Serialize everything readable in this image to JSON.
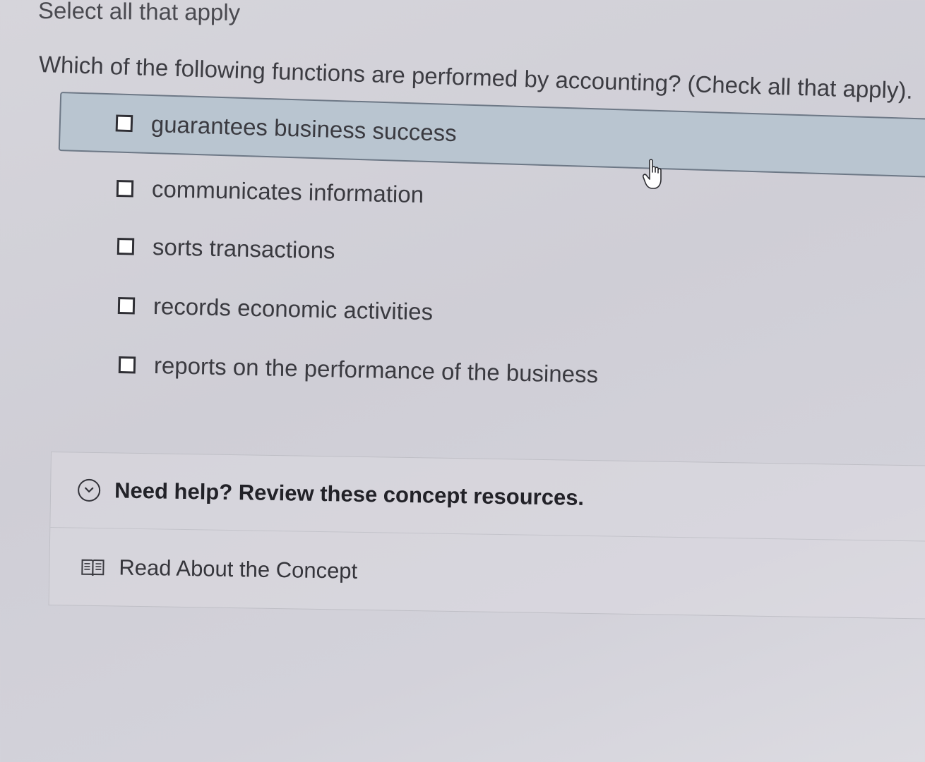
{
  "instruction": "Select all that apply",
  "question": "Which of the following functions are performed by accounting? (Check all that apply).",
  "options": [
    {
      "label": "guarantees business success",
      "checked": false,
      "highlighted": true
    },
    {
      "label": "communicates information",
      "checked": false
    },
    {
      "label": "sorts transactions",
      "checked": false
    },
    {
      "label": "records economic activities",
      "checked": false
    },
    {
      "label": "reports on the performance of the business",
      "checked": false
    }
  ],
  "help": {
    "title": "Need help? Review these concept resources.",
    "icon": "chevron-down-circle-icon",
    "resources": [
      {
        "label": "Read About the Concept",
        "icon": "book-icon"
      }
    ]
  },
  "colors": {
    "highlight": "#b9c5d0",
    "background": "#d3d2da"
  }
}
